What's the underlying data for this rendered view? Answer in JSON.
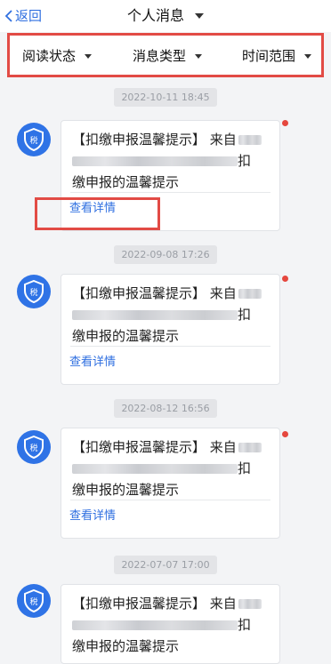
{
  "header": {
    "back_label": "返回",
    "title": "个人消息"
  },
  "filters": [
    {
      "label": "阅读状态"
    },
    {
      "label": "消息类型"
    },
    {
      "label": "时间范围"
    }
  ],
  "messages": [
    {
      "timestamp": "2022-10-11 18:45",
      "avatar_text": "税",
      "line1": "【扣缴申报温馨提示】 来自",
      "line2_end": "扣",
      "line3": "缴申报的温馨提示",
      "link": "查看详情",
      "unread": true
    },
    {
      "timestamp": "2022-09-08 17:26",
      "avatar_text": "税",
      "line1": "【扣缴申报温馨提示】 来自",
      "line2_end": "扣",
      "line3": "缴申报的温馨提示",
      "link": "查看详情",
      "unread": true
    },
    {
      "timestamp": "2022-08-12 16:56",
      "avatar_text": "税",
      "line1": "【扣缴申报温馨提示】 来自",
      "line2_end": "扣",
      "line3": "缴申报的温馨提示",
      "link": "查看详情",
      "unread": true
    },
    {
      "timestamp": "2022-07-07 17:00",
      "avatar_text": "税",
      "line1": "【扣缴申报温馨提示】 来自",
      "line2_end": "扣",
      "line3": "缴申报的温馨提示",
      "link": "",
      "unread": false
    }
  ],
  "colors": {
    "accent": "#2f6fe0",
    "highlight": "#e24b45",
    "badge": "#e5473e",
    "avatar": "#2f73e6"
  }
}
